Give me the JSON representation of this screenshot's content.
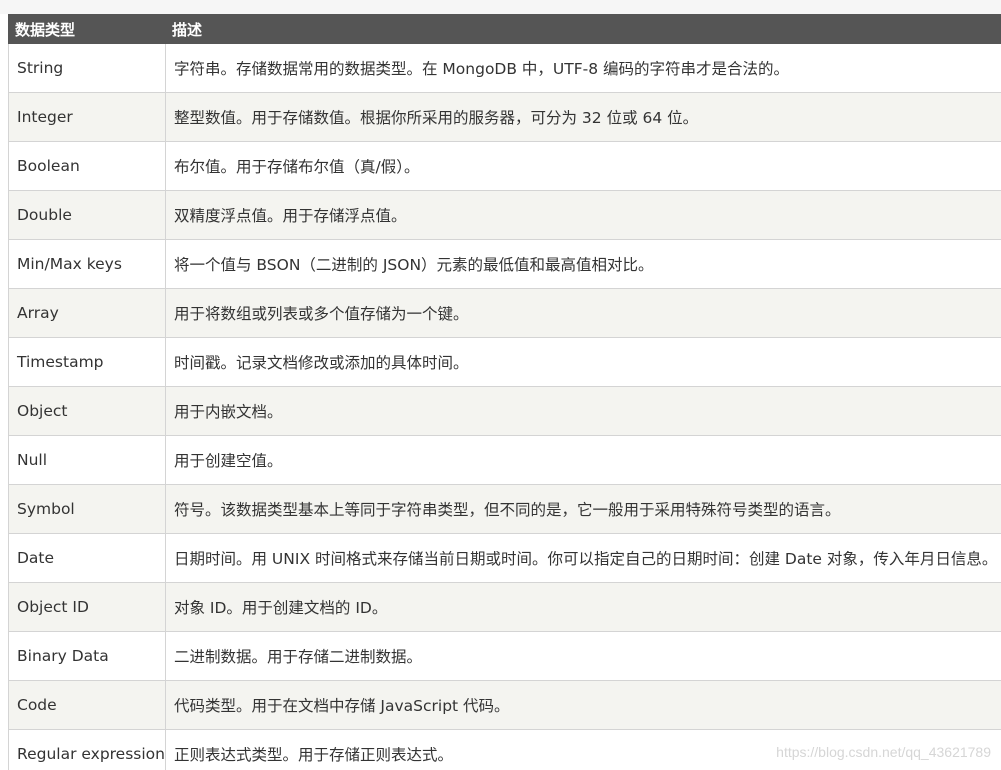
{
  "table": {
    "headers": [
      "数据类型",
      "描述"
    ],
    "rows": [
      [
        "String",
        "字符串。存储数据常用的数据类型。在 MongoDB 中，UTF-8 编码的字符串才是合法的。"
      ],
      [
        "Integer",
        "整型数值。用于存储数值。根据你所采用的服务器，可分为 32 位或 64 位。"
      ],
      [
        "Boolean",
        "布尔值。用于存储布尔值（真/假）。"
      ],
      [
        "Double",
        "双精度浮点值。用于存储浮点值。"
      ],
      [
        "Min/Max keys",
        "将一个值与 BSON（二进制的 JSON）元素的最低值和最高值相对比。"
      ],
      [
        "Array",
        "用于将数组或列表或多个值存储为一个键。"
      ],
      [
        "Timestamp",
        "时间戳。记录文档修改或添加的具体时间。"
      ],
      [
        "Object",
        "用于内嵌文档。"
      ],
      [
        "Null",
        "用于创建空值。"
      ],
      [
        "Symbol",
        "符号。该数据类型基本上等同于字符串类型，但不同的是，它一般用于采用特殊符号类型的语言。"
      ],
      [
        "Date",
        "日期时间。用 UNIX 时间格式来存储当前日期或时间。你可以指定自己的日期时间：创建 Date 对象，传入年月日信息。"
      ],
      [
        "Object ID",
        "对象 ID。用于创建文档的 ID。"
      ],
      [
        "Binary Data",
        "二进制数据。用于存储二进制数据。"
      ],
      [
        "Code",
        "代码类型。用于在文档中存储 JavaScript 代码。"
      ],
      [
        "Regular expression",
        "正则表达式类型。用于存储正则表达式。"
      ]
    ]
  },
  "watermark": "https://blog.csdn.net/qq_43621789"
}
